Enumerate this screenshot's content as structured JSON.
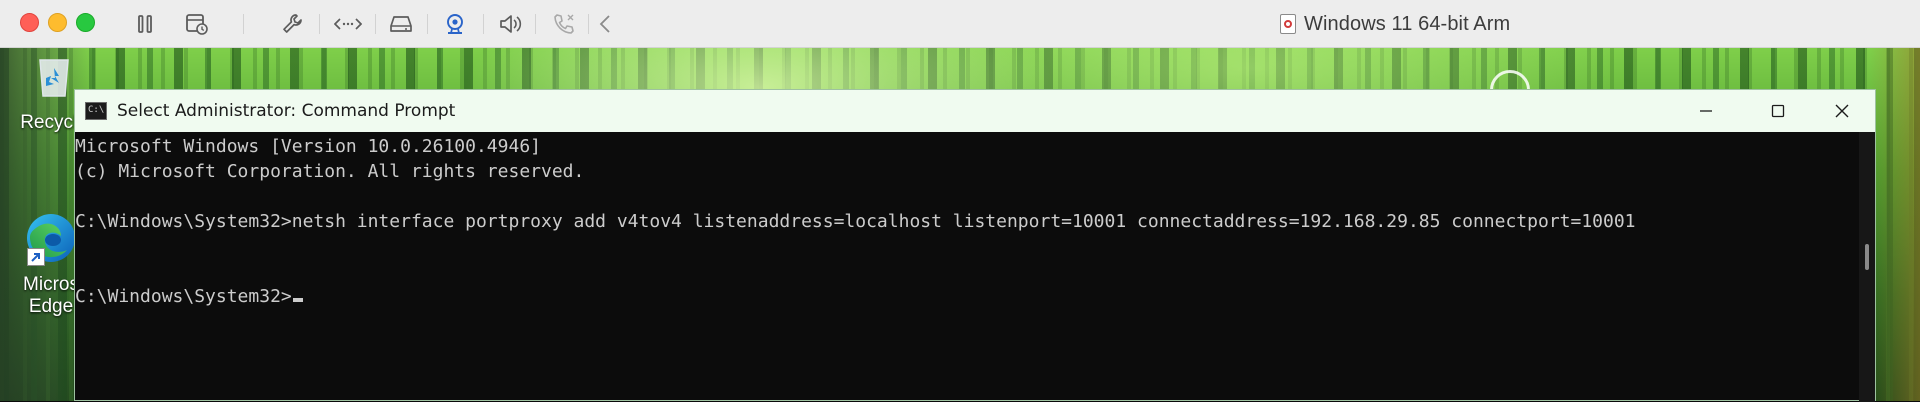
{
  "vm_window": {
    "title": "Windows 11 64-bit Arm",
    "toolbar_icons": [
      "pause-icon",
      "snapshot-icon",
      "settings-wrench-icon",
      "code-arrows-icon",
      "hard-drive-icon",
      "camera-icon",
      "speaker-icon",
      "phone-icon",
      "back-chevron-icon"
    ]
  },
  "desktop": {
    "icons": [
      {
        "label": "Recycle",
        "icon": "recycle-bin-icon"
      },
      {
        "label_line1": "Micros",
        "label_line2": "Edge",
        "icon": "edge-browser-icon"
      }
    ]
  },
  "cmd": {
    "title": "Select Administrator: Command Prompt",
    "icon_text": "C:\\",
    "lines": [
      "Microsoft Windows [Version 10.0.26100.4946]",
      "(c) Microsoft Corporation. All rights reserved.",
      "",
      "C:\\Windows\\System32>netsh interface portproxy add v4tov4 listenaddress=localhost listenport=10001 connectaddress=192.168.29.85 connectport=10001",
      "",
      "",
      "C:\\Windows\\System32>"
    ]
  },
  "colors": {
    "terminal_bg": "#0c0c0c",
    "terminal_fg": "#cccccc",
    "titlebar_bg": "#f0fbf0",
    "toolbar_bg": "#ededed"
  }
}
